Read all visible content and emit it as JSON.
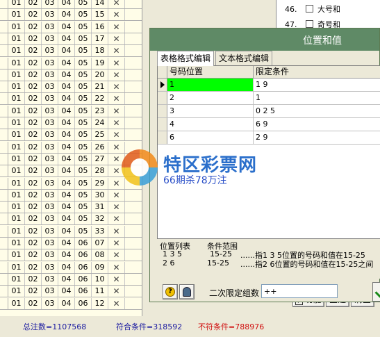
{
  "grid": {
    "rows": [
      [
        "01",
        "02",
        "03",
        "04",
        "05",
        "14"
      ],
      [
        "01",
        "02",
        "03",
        "04",
        "05",
        "15"
      ],
      [
        "01",
        "02",
        "03",
        "04",
        "05",
        "16"
      ],
      [
        "01",
        "02",
        "03",
        "04",
        "05",
        "17"
      ],
      [
        "01",
        "02",
        "03",
        "04",
        "05",
        "18"
      ],
      [
        "01",
        "02",
        "03",
        "04",
        "05",
        "19"
      ],
      [
        "01",
        "02",
        "03",
        "04",
        "05",
        "20"
      ],
      [
        "01",
        "02",
        "03",
        "04",
        "05",
        "21"
      ],
      [
        "01",
        "02",
        "03",
        "04",
        "05",
        "22"
      ],
      [
        "01",
        "02",
        "03",
        "04",
        "05",
        "23"
      ],
      [
        "01",
        "02",
        "03",
        "04",
        "05",
        "24"
      ],
      [
        "01",
        "02",
        "03",
        "04",
        "05",
        "25"
      ],
      [
        "01",
        "02",
        "03",
        "04",
        "05",
        "26"
      ],
      [
        "01",
        "02",
        "03",
        "04",
        "05",
        "27"
      ],
      [
        "01",
        "02",
        "03",
        "04",
        "05",
        "28"
      ],
      [
        "01",
        "02",
        "03",
        "04",
        "05",
        "29"
      ],
      [
        "01",
        "02",
        "03",
        "04",
        "05",
        "30"
      ],
      [
        "01",
        "02",
        "03",
        "04",
        "05",
        "31"
      ],
      [
        "01",
        "02",
        "03",
        "04",
        "05",
        "32"
      ],
      [
        "01",
        "02",
        "03",
        "04",
        "05",
        "33"
      ],
      [
        "01",
        "02",
        "03",
        "04",
        "06",
        "07"
      ],
      [
        "01",
        "02",
        "03",
        "04",
        "06",
        "08"
      ],
      [
        "01",
        "02",
        "03",
        "04",
        "06",
        "09"
      ],
      [
        "01",
        "02",
        "03",
        "04",
        "06",
        "10"
      ],
      [
        "01",
        "02",
        "03",
        "04",
        "06",
        "11"
      ],
      [
        "01",
        "02",
        "03",
        "04",
        "06",
        "12"
      ]
    ],
    "mark": "✕"
  },
  "status": {
    "total": "总注数=1107568",
    "match": "符合条件=318592",
    "nomatch": "不符条件=788976"
  },
  "right_list": [
    {
      "num": "46.",
      "label": "大号和"
    },
    {
      "num": "47.",
      "label": "奇号和"
    }
  ],
  "right_buttons": {
    "func": "功能",
    "all": "全选",
    "clear": "清空"
  },
  "dialog": {
    "title": "位置和值",
    "tabs": [
      "表格格式编辑",
      "文本格式编辑"
    ],
    "columns": [
      "号码位置",
      "限定条件"
    ],
    "rows": [
      {
        "pos": "1",
        "cond": "1 9"
      },
      {
        "pos": "2",
        "cond": "1"
      },
      {
        "pos": "3",
        "cond": "0 2 5"
      },
      {
        "pos": "4",
        "cond": "6 9"
      },
      {
        "pos": "6",
        "cond": "2 9"
      }
    ],
    "info": {
      "head_pos": "位置列表",
      "head_range": "条件范围",
      "line1_pos": "1 3 5",
      "line1_range": "15-25",
      "line1_desc": "......指1 3 5位置的号码和值在15-25",
      "line2_pos": "2 6",
      "line2_range": "15-25",
      "line2_desc": "......指2 6位置的号码和值在15-25之间"
    },
    "second_label": "二次限定组数",
    "second_value": "++"
  },
  "watermark": {
    "name": "特区彩票网",
    "sub": "66期杀78万注"
  }
}
